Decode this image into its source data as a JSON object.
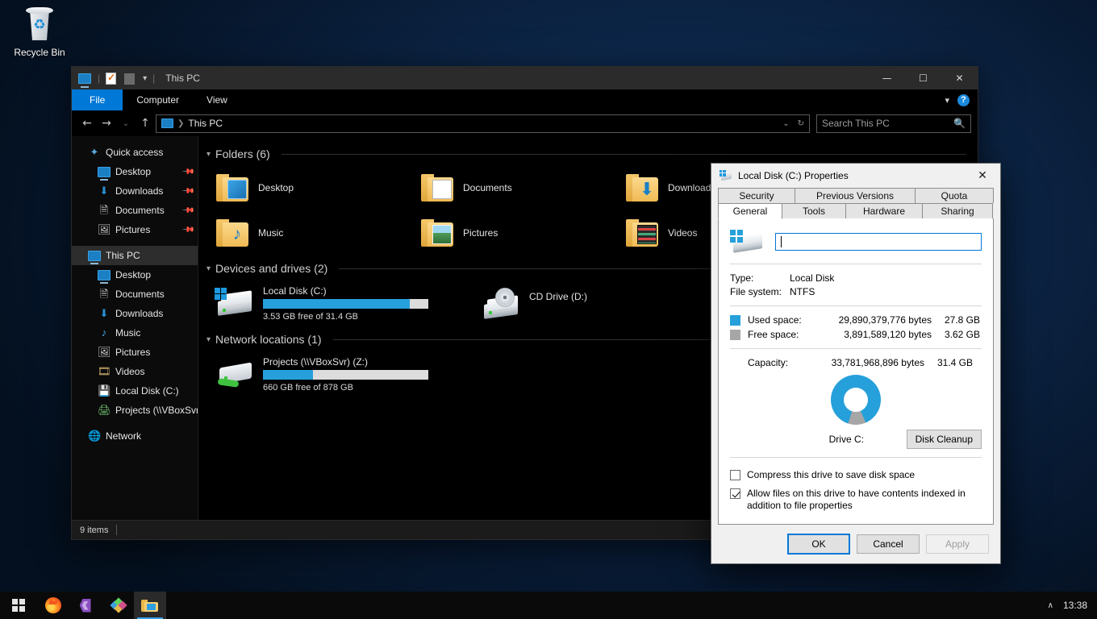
{
  "desktop": {
    "icons": [
      {
        "label": "Recycle Bin",
        "icon": "recycle-bin-icon"
      }
    ],
    "wallpaper_color": "#0a2murky"
  },
  "explorer": {
    "title": "This PC",
    "quick_access_toolbar": [
      {
        "name": "this-pc-icon",
        "icon": "monitor-icon"
      },
      {
        "name": "properties-icon",
        "icon": "note-checked-icon"
      },
      {
        "name": "new-folder-icon",
        "icon": "square-icon"
      },
      {
        "name": "customize-qat",
        "icon": "chevron-down-icon"
      }
    ],
    "window_controls": {
      "minimize": "—",
      "maximize": "☐",
      "close": "✕"
    },
    "ribbon_tabs": [
      {
        "label": "File",
        "active": true
      },
      {
        "label": "Computer",
        "active": false
      },
      {
        "label": "View",
        "active": false
      }
    ],
    "ribbon_help": "?",
    "address": {
      "back": "←",
      "forward": "→",
      "recent": "⌄",
      "up": "↑",
      "crumb": "This PC",
      "refresh": "↻",
      "dropdown": "⌄"
    },
    "search": {
      "placeholder": "Search This PC",
      "value": ""
    },
    "nav_pane": [
      {
        "label": "Quick access",
        "icon": "star-icon",
        "level": 0,
        "selected": false,
        "pinned": false
      },
      {
        "label": "Desktop",
        "icon": "monitor-icon",
        "level": 1,
        "selected": false,
        "pinned": true
      },
      {
        "label": "Downloads",
        "icon": "download-icon",
        "level": 1,
        "selected": false,
        "pinned": true
      },
      {
        "label": "Documents",
        "icon": "document-icon",
        "level": 1,
        "selected": false,
        "pinned": true
      },
      {
        "label": "Pictures",
        "icon": "picture-icon",
        "level": 1,
        "selected": false,
        "pinned": true
      },
      {
        "label": "This PC",
        "icon": "monitor-icon",
        "level": 0,
        "selected": true,
        "pinned": false
      },
      {
        "label": "Desktop",
        "icon": "monitor-icon",
        "level": 1,
        "selected": false,
        "pinned": false
      },
      {
        "label": "Documents",
        "icon": "document-icon",
        "level": 1,
        "selected": false,
        "pinned": false
      },
      {
        "label": "Downloads",
        "icon": "download-icon",
        "level": 1,
        "selected": false,
        "pinned": false
      },
      {
        "label": "Music",
        "icon": "music-note-icon",
        "level": 1,
        "selected": false,
        "pinned": false
      },
      {
        "label": "Pictures",
        "icon": "picture-icon",
        "level": 1,
        "selected": false,
        "pinned": false
      },
      {
        "label": "Videos",
        "icon": "video-icon",
        "level": 1,
        "selected": false,
        "pinned": false
      },
      {
        "label": "Local Disk (C:)",
        "icon": "hard-drive-icon",
        "level": 1,
        "selected": false,
        "pinned": false
      },
      {
        "label": "Projects (\\\\VBoxSvr)",
        "icon": "network-drive-icon",
        "level": 1,
        "selected": false,
        "pinned": false
      },
      {
        "label": "Network",
        "icon": "network-icon",
        "level": 0,
        "selected": false,
        "pinned": false
      }
    ],
    "groups": [
      {
        "title": "Folders (6)"
      },
      {
        "title": "Devices and drives (2)"
      },
      {
        "title": "Network locations (1)"
      }
    ],
    "folders": [
      {
        "label": "Desktop",
        "icon": "folder-desktop-icon"
      },
      {
        "label": "Documents",
        "icon": "folder-documents-icon"
      },
      {
        "label": "Downloads",
        "icon": "folder-downloads-icon"
      },
      {
        "label": "Music",
        "icon": "folder-music-icon"
      },
      {
        "label": "Pictures",
        "icon": "folder-pictures-icon"
      },
      {
        "label": "Videos",
        "icon": "folder-videos-icon"
      }
    ],
    "drives": [
      {
        "label": "Local Disk (C:)",
        "icon": "windows-hard-drive-icon",
        "free_text": "3.53 GB free of 31.4 GB",
        "used_percent": 89,
        "has_bar": true
      },
      {
        "label": "CD Drive (D:)",
        "icon": "cd-drive-icon",
        "free_text": "",
        "used_percent": 0,
        "has_bar": false
      }
    ],
    "network_locations": [
      {
        "label": "Projects (\\\\VBoxSvr) (Z:)",
        "icon": "network-drive-icon",
        "free_text": "660 GB free of 878 GB",
        "used_percent": 30,
        "has_bar": true
      }
    ],
    "status": {
      "items": "9 items"
    }
  },
  "properties_dialog": {
    "title": "Local Disk (C:) Properties",
    "close_label": "✕",
    "tabs_top": [
      {
        "label": "Security",
        "active": false
      },
      {
        "label": "Previous Versions",
        "active": false
      },
      {
        "label": "Quota",
        "active": false
      }
    ],
    "tabs_bottom": [
      {
        "label": "General",
        "active": true
      },
      {
        "label": "Tools",
        "active": false
      },
      {
        "label": "Hardware",
        "active": false
      },
      {
        "label": "Sharing",
        "active": false
      }
    ],
    "volume_label": {
      "value": "",
      "placeholder": ""
    },
    "type": {
      "key": "Type:",
      "value": "Local Disk"
    },
    "file_system": {
      "key": "File system:",
      "value": "NTFS"
    },
    "used_space": {
      "key": "Used space:",
      "bytes": "29,890,379,776 bytes",
      "gb": "27.8 GB",
      "color": "#26a0da"
    },
    "free_space": {
      "key": "Free space:",
      "bytes": "3,891,589,120 bytes",
      "gb": "3.62 GB",
      "color": "#a6a6a6"
    },
    "capacity": {
      "key": "Capacity:",
      "bytes": "33,781,968,896 bytes",
      "gb": "31.4 GB"
    },
    "drive_caption": "Drive C:",
    "disk_cleanup_button": "Disk Cleanup",
    "checkboxes": [
      {
        "label": "Compress this drive to save disk space",
        "checked": false
      },
      {
        "label": "Allow files on this drive to have contents indexed in addition to file properties",
        "checked": true
      }
    ],
    "buttons": [
      {
        "label": "OK",
        "state": "default"
      },
      {
        "label": "Cancel",
        "state": "normal"
      },
      {
        "label": "Apply",
        "state": "disabled"
      }
    ],
    "chart_data": {
      "type": "pie",
      "title": "Drive C:",
      "categories": [
        "Used space",
        "Free space"
      ],
      "values": [
        88.5,
        11.5
      ],
      "colors": [
        "#26a0da",
        "#a6a6a6"
      ],
      "units": "percent"
    }
  },
  "taskbar": {
    "start": {
      "name": "start-button"
    },
    "apps": [
      {
        "name": "firefox",
        "active": false
      },
      {
        "name": "visual-studio",
        "active": false
      },
      {
        "name": "gitkraken",
        "active": false
      },
      {
        "name": "file-explorer",
        "active": true
      }
    ],
    "tray": {
      "chevron": "∧",
      "clock": "13:38"
    }
  }
}
